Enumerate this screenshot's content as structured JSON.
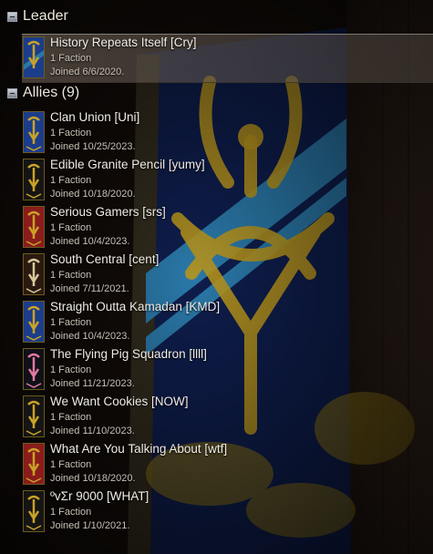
{
  "sections": {
    "leader": {
      "label": "Leader"
    },
    "allies": {
      "label": "Allies (9)"
    }
  },
  "leader": {
    "name": "History Repeats Itself [Cry]",
    "faction": "1 Faction",
    "joined": "Joined 6/6/2020.",
    "emblem_colors": [
      "#1c3d8a",
      "#c9a227"
    ]
  },
  "allies": [
    {
      "name": "Clan Union [Uni]",
      "faction": "1 Faction",
      "joined": "Joined 10/25/2023.",
      "emblem_colors": [
        "#1c3d8a",
        "#c9a227"
      ]
    },
    {
      "name": "Edible Granite Pencil [yumy]",
      "faction": "1 Faction",
      "joined": "Joined 10/18/2020.",
      "emblem_colors": [
        "#151515",
        "#c9a227"
      ]
    },
    {
      "name": "Serious Gamers [srs]",
      "faction": "1 Faction",
      "joined": "Joined 10/4/2023.",
      "emblem_colors": [
        "#8a1c1c",
        "#c9a227"
      ]
    },
    {
      "name": "South Central [cent]",
      "faction": "1 Faction",
      "joined": "Joined 7/11/2021.",
      "emblem_colors": [
        "#2a1a10",
        "#d8c89a"
      ]
    },
    {
      "name": "Straight Outta Kamadan [KMD]",
      "faction": "1 Faction",
      "joined": "Joined 10/4/2023.",
      "emblem_colors": [
        "#1c3d8a",
        "#c9a227"
      ]
    },
    {
      "name": "The Flying Pig Squadron [llll]",
      "faction": "1 Faction",
      "joined": "Joined 11/21/2023.",
      "emblem_colors": [
        "#101018",
        "#e07aa0"
      ]
    },
    {
      "name": "We Want Cookies [NOW]",
      "faction": "1 Faction",
      "joined": "Joined 11/10/2023.",
      "emblem_colors": [
        "#151515",
        "#c9a227"
      ]
    },
    {
      "name": "What Are You Talking About [wtf]",
      "faction": "1 Faction",
      "joined": "Joined 10/18/2020.",
      "emblem_colors": [
        "#8a1c1c",
        "#c9a227"
      ]
    },
    {
      "name": "ºvΣr 9000 [WHAT]",
      "faction": "1 Faction",
      "joined": "Joined 1/10/2021.",
      "emblem_colors": [
        "#151515",
        "#c9a227"
      ]
    }
  ],
  "colors": {
    "banner_gold": "#c9a227",
    "banner_blue": "#2a6f9e",
    "banner_navy": "#0d1a44",
    "selection": "#6e6258"
  }
}
